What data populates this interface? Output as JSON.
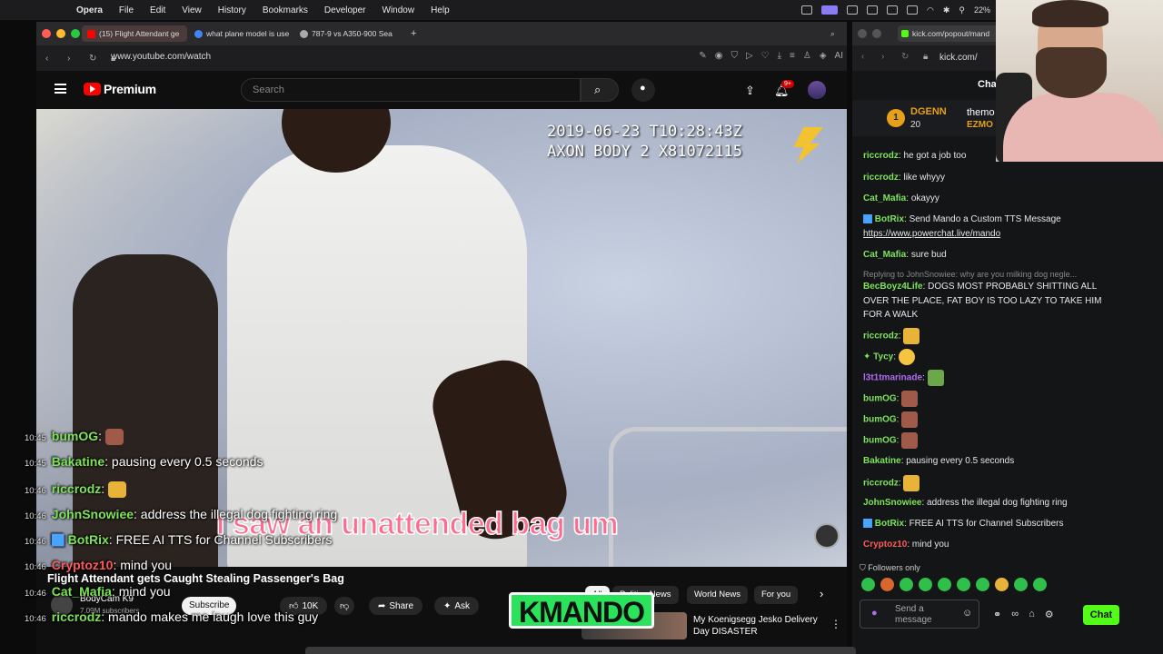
{
  "menubar": {
    "app": "Opera",
    "items": [
      "File",
      "Edit",
      "View",
      "History",
      "Bookmarks",
      "Developer",
      "Window",
      "Help"
    ],
    "battery": "22%"
  },
  "left_window": {
    "tabs": [
      {
        "label": "(15) Flight Attendant ge",
        "favicon_color": "#ff0000",
        "active": true
      },
      {
        "label": "what plane model is use",
        "favicon_color": "#4285f4",
        "active": false
      },
      {
        "label": "787-9 vs A350-900 Sea",
        "favicon_color": "#aaaaaa",
        "active": false
      }
    ],
    "new_tab_icon": "plus-icon",
    "url": "www.youtube.com/watch",
    "ai_label": "AI"
  },
  "youtube": {
    "brand": "Premium",
    "search_placeholder": "Search",
    "notification_count": "9+",
    "video": {
      "timestamp_line1": "2019-06-23 T10:28:43Z",
      "timestamp_line2": "AXON BODY 2 X81072115",
      "caption": "I saw an unattended bag um"
    },
    "title": "Flight Attendant gets Caught Stealing Passenger's Bag",
    "channel": "BodyCam K9",
    "subscribers": "7.09M subscribers",
    "subscribe_label": "Subscribe",
    "likes": "10K",
    "share_label": "Share",
    "ask_label": "Ask",
    "chips": [
      {
        "label": "All",
        "selected": true
      },
      {
        "label": "Politics News",
        "selected": false
      },
      {
        "label": "World News",
        "selected": false
      },
      {
        "label": "For you",
        "selected": false
      }
    ],
    "recommended": {
      "title": "My Koenigsegg Jesko Delivery Day DISASTER"
    }
  },
  "overlay_chat": [
    {
      "time": "10:45",
      "user": "bumOG",
      "user_color": "#7ee35a",
      "text": "",
      "emote": true
    },
    {
      "time": "10:45",
      "user": "Bakatine",
      "user_color": "#7ee35a",
      "text": "pausing every 0.5 seconds",
      "emote": false
    },
    {
      "time": "10:46",
      "user": "riccrodz",
      "user_color": "#7ee35a",
      "text": "",
      "emote": true
    },
    {
      "time": "10:46",
      "user": "JohnSnowiee",
      "user_color": "#7ee35a",
      "text": "address the illegal dog fighting ring",
      "emote": false
    },
    {
      "time": "10:46",
      "user": "BotRix",
      "user_color": "#7ee35a",
      "text": "FREE AI TTS for Channel Subscribers",
      "emote": false
    },
    {
      "time": "10:46",
      "user": "Cryptoz10",
      "user_color": "#ff5a5a",
      "text": "mind you",
      "emote": false
    },
    {
      "time": "10:46",
      "user": "Cat_Mafia",
      "user_color": "#7ee35a",
      "text": "mind you",
      "emote": false
    },
    {
      "time": "10:46",
      "user": "riccrodz",
      "user_color": "#7ee35a",
      "text": "mando makes me laugh love this guy",
      "emote": false
    }
  ],
  "mando_logo": "MANDO",
  "right_window": {
    "tab_label": "kick.com/popout/mand",
    "url": "kick.com/",
    "chat_header": "Cha",
    "pinned": {
      "rank": "1",
      "user": "DGENN",
      "count": "20",
      "user2": "themo",
      "user3": "EZMO"
    },
    "messages": [
      {
        "user": "riccrodz",
        "color": "#7ee35a",
        "text": "he got a job too"
      },
      {
        "user": "riccrodz",
        "color": "#7ee35a",
        "text": "like whyyy"
      },
      {
        "user": "Cat_Mafia",
        "color": "#7ee35a",
        "text": "okayyy"
      },
      {
        "user": "BotRix",
        "color": "#7ee35a",
        "text": "Send Mando a Custom TTS Message",
        "link": "https://www.powerchat.live/mando"
      },
      {
        "user": "Cat_Mafia",
        "color": "#7ee35a",
        "text": "sure bud"
      },
      {
        "reply": "Replying to JohnSnowiee: why are you milking dog negle..."
      },
      {
        "user": "BecBoyz4Life",
        "color": "#7ee35a",
        "text": "DOGS MOST PROBABLY SHITTING ALL OVER THE PLACE, FAT BOY IS TOO LAZY TO TAKE HIM FOR A WALK"
      },
      {
        "user": "riccrodz",
        "color": "#7ee35a",
        "text": "",
        "emote": "#e8b339"
      },
      {
        "user": "Tycy",
        "color": "#7ee35a",
        "text": "",
        "emote": "#f5c542"
      },
      {
        "user": "l3t1tmarinade",
        "color": "#b06cf0",
        "text": "",
        "emote": "#6ca84a"
      },
      {
        "user": "bumOG",
        "color": "#7ee35a",
        "text": "",
        "emote": "#a05a4a"
      },
      {
        "user": "bumOG",
        "color": "#7ee35a",
        "text": "",
        "emote": "#a05a4a"
      },
      {
        "user": "bumOG",
        "color": "#7ee35a",
        "text": "",
        "emote": "#a05a4a"
      },
      {
        "user": "Bakatine",
        "color": "#7ee35a",
        "text": "pausing every 0.5 seconds"
      },
      {
        "user": "riccrodz",
        "color": "#7ee35a",
        "text": "",
        "emote": "#e8b339"
      },
      {
        "user": "JohnSnowiee",
        "color": "#7ee35a",
        "text": "address the illegal dog fighting ring"
      },
      {
        "user": "BotRix",
        "color": "#7ee35a",
        "text": "FREE AI TTS for Channel Subscribers"
      },
      {
        "user": "Cryptoz10",
        "color": "#ff5a5a",
        "text": "mind you"
      }
    ],
    "followers_only": "Followers only",
    "message_placeholder": "Send a message",
    "chat_button": "Chat"
  }
}
